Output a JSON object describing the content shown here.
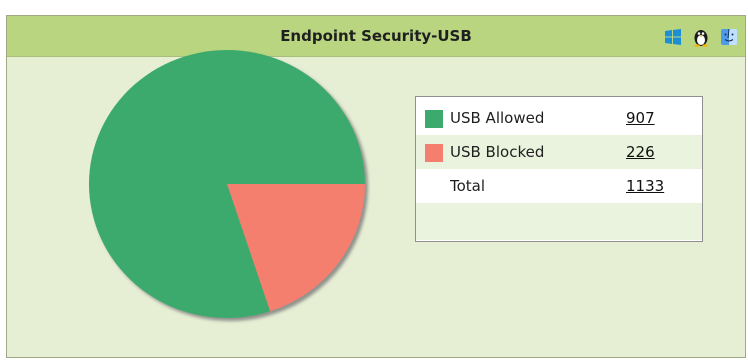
{
  "widget": {
    "title": "Endpoint Security-USB",
    "os_icons": [
      "windows-icon",
      "linux-icon",
      "mac-icon"
    ]
  },
  "legend": {
    "rows": [
      {
        "label": "USB Allowed",
        "value": "907",
        "color": "#3daa6d"
      },
      {
        "label": "USB Blocked",
        "value": "226",
        "color": "#f47f6e"
      },
      {
        "label": "Total",
        "value": "1133"
      }
    ]
  },
  "chart_data": {
    "type": "pie",
    "categories": [
      "USB Allowed",
      "USB Blocked"
    ],
    "values": [
      907,
      226
    ],
    "colors": [
      "#3daa6d",
      "#f47f6e"
    ],
    "total": 1133
  }
}
